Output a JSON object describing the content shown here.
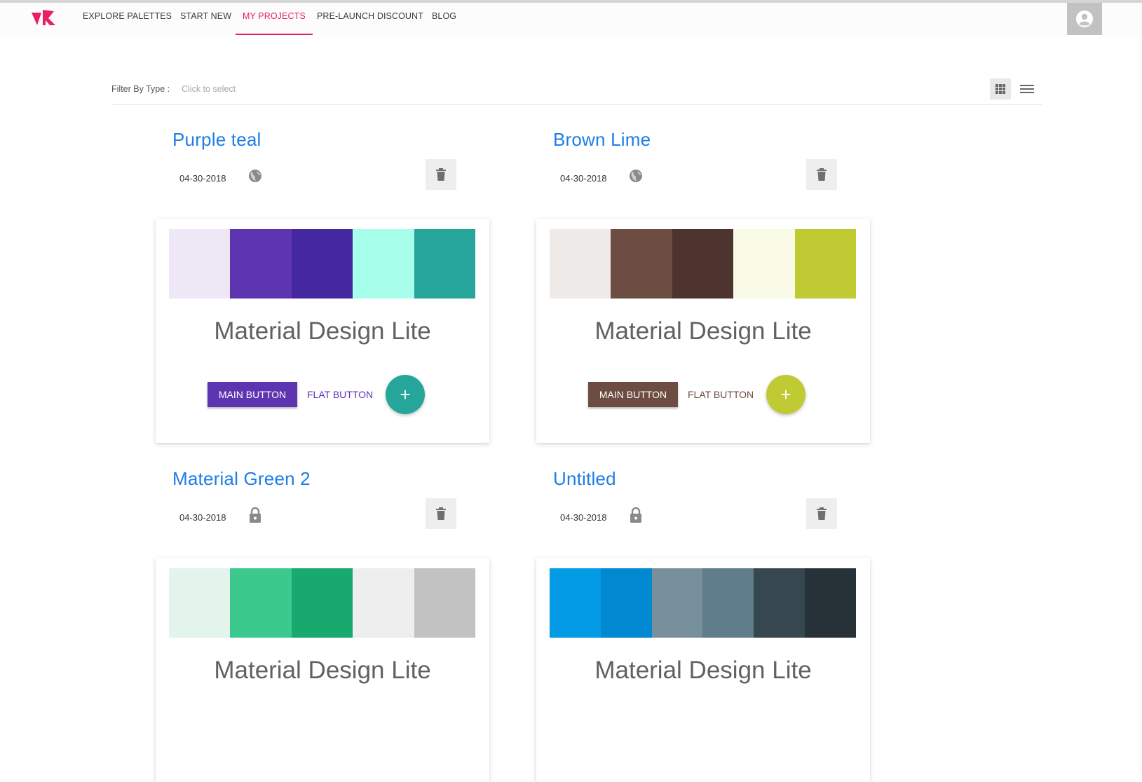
{
  "nav": {
    "items": [
      {
        "label": "EXPLORE PALETTES"
      },
      {
        "label": "START NEW"
      },
      {
        "label": "MY PROJECTS"
      },
      {
        "label": "PRE-LAUNCH DISCOUNT"
      },
      {
        "label": "BLOG"
      }
    ],
    "active_color": "#e91e63"
  },
  "filter": {
    "label": "Filter By Type :",
    "placeholder": "Click to select"
  },
  "projects": [
    {
      "title": "Purple teal",
      "date": "04-30-2018",
      "visibility": "globe-icon",
      "swatches": [
        "#ede7f6",
        "#5e35b1",
        "#4527a0",
        "#a7ffeb",
        "#26a69a"
      ],
      "preview_title": "Material Design Lite",
      "main_button": "MAIN BUTTON",
      "flat_button": "FLAT BUTTON",
      "fab_label": "+",
      "primary": "#5e35b1",
      "accent": "#26a69a"
    },
    {
      "title": "Brown Lime",
      "date": "04-30-2018",
      "visibility": "globe-icon",
      "swatches": [
        "#efebe9",
        "#6d4c41",
        "#4e342e",
        "#f9fbe7",
        "#c0ca33"
      ],
      "preview_title": "Material Design Lite",
      "main_button": "MAIN BUTTON",
      "flat_button": "FLAT BUTTON",
      "fab_label": "+",
      "primary": "#6d4c41",
      "accent": "#c0ca33"
    },
    {
      "title": "Material Green 2",
      "date": "04-30-2018",
      "visibility": "lock-icon",
      "swatches": [
        "#e3f4ec",
        "#3bc98e",
        "#18a96e",
        "#eeeeee",
        "#c2c2c2"
      ],
      "preview_title": "Material Design Lite",
      "primary": "#18a96e",
      "accent": "#3bc98e"
    },
    {
      "title": "Untitled",
      "date": "04-30-2018",
      "visibility": "lock-icon",
      "swatches": [
        "#039be5",
        "#0288d1",
        "#78909c",
        "#607d8b",
        "#37474f",
        "#263238"
      ],
      "preview_title": "Material Design Lite",
      "primary": "#0288d1",
      "accent": "#039be5"
    }
  ]
}
